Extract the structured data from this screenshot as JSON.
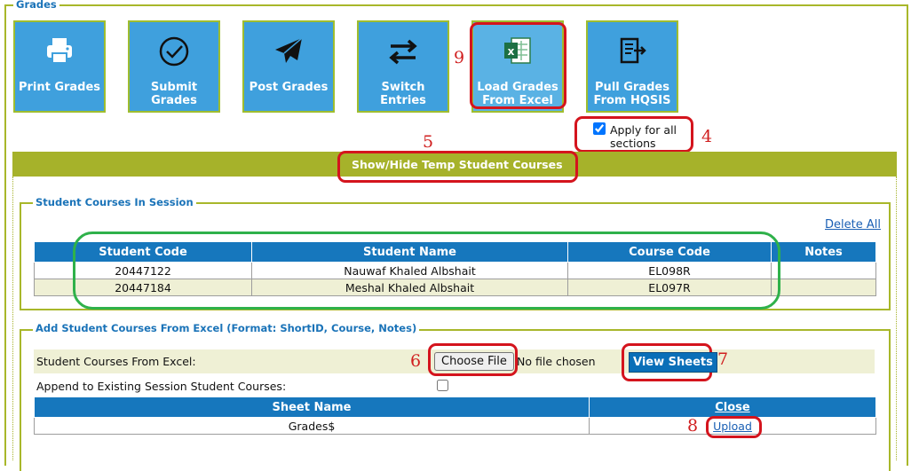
{
  "legends": {
    "grades": "Grades",
    "student_courses": "Student Courses In Session",
    "add_from_excel": "Add Student Courses From Excel (Format: ShortID, Course, Notes)"
  },
  "tiles": [
    {
      "label": "Print Grades",
      "icon": "printer-icon"
    },
    {
      "label": "Submit Grades",
      "icon": "check-circle-icon"
    },
    {
      "label": "Post Grades",
      "icon": "paper-plane-icon"
    },
    {
      "label": "Switch Entries",
      "icon": "swap-arrows-icon"
    },
    {
      "label_line1": "Load Grades",
      "label_line2": "From Excel",
      "icon": "excel-icon"
    },
    {
      "label_line1": "Pull Grades",
      "label_line2": "From HQSIS",
      "icon": "export-doc-icon"
    }
  ],
  "apply_all": {
    "line1": "Apply for all",
    "line2": "sections",
    "checked": true
  },
  "toggle_temp": "Show/Hide Temp Student Courses",
  "annotations": [
    "9",
    "5",
    "4",
    "6",
    "7",
    "8"
  ],
  "session_courses": {
    "delete_all": "Delete All",
    "columns": [
      "Student Code",
      "Student Name",
      "Course Code",
      "Notes"
    ],
    "rows": [
      {
        "code": "20447122",
        "name": "Nauwaf Khaled Albshait",
        "course": "EL098R",
        "notes": ""
      },
      {
        "code": "20447184",
        "name": "Meshal Khaled Albshait",
        "course": "EL097R",
        "notes": ""
      }
    ]
  },
  "excel_upload": {
    "file_label": "Student Courses From Excel:",
    "choose_file": "Choose File",
    "no_file": "No file chosen",
    "view_sheets": "View Sheets",
    "append_label": "Append to Existing Session Student Courses:",
    "append_checked": false,
    "sheet_columns": [
      "Sheet Name",
      "Close"
    ],
    "sheets": [
      {
        "name": "Grades$",
        "action": "Upload"
      }
    ]
  },
  "colors": {
    "tile_blue": "#3fa0dd",
    "olive": "#a6b22a",
    "header_blue": "#1677bd",
    "annotation_red": "#d4141d"
  }
}
